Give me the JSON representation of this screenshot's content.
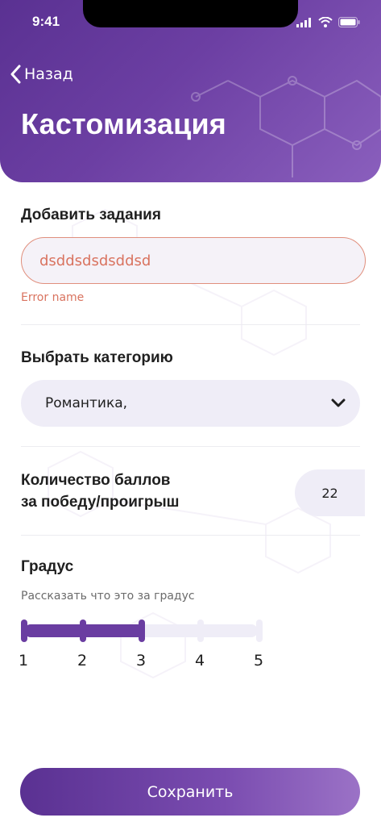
{
  "status_bar": {
    "time": "9:41"
  },
  "header": {
    "back_label": "Назад",
    "title": "Кастомизация"
  },
  "task_section": {
    "label": "Добавить задания",
    "input_value": "dsddsdsdsddsd",
    "error": "Error name"
  },
  "category_section": {
    "label": "Выбрать категорию",
    "selected": "Романтика,"
  },
  "points_section": {
    "label_line1": "Количество баллов",
    "label_line2": "за победу/проигрыш",
    "value": "22"
  },
  "degree_section": {
    "label": "Градус",
    "subtitle": "Рассказать что это за градус",
    "ticks": [
      "1",
      "2",
      "3",
      "4",
      "5"
    ],
    "selected_level": 3
  },
  "colors": {
    "accent": "#6a3da1",
    "error": "#d9735f",
    "field_bg": "#efedf7"
  },
  "save_button": {
    "label": "Сохранить"
  }
}
